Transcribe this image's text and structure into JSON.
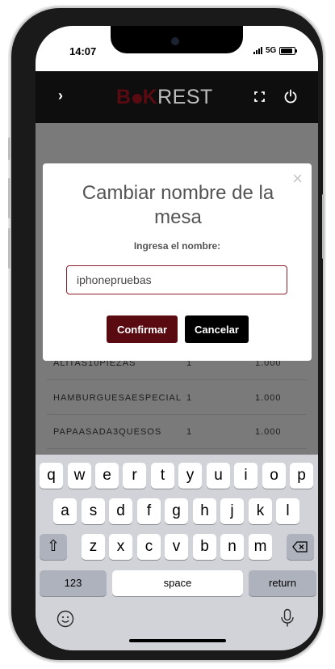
{
  "status": {
    "time": "14:07",
    "network": "5G"
  },
  "app": {
    "logo_b": "B",
    "logo_k": "K",
    "logo_rest": "REST"
  },
  "orders": [
    {
      "name": "ALITAS10PIEZAS",
      "qty": "1",
      "price": "1.000"
    },
    {
      "name": "HAMBURGUESAESPECIAL",
      "qty": "1",
      "price": "1.000"
    },
    {
      "name": "PAPAASADA3QUESOS",
      "qty": "1",
      "price": "1.000"
    }
  ],
  "modal": {
    "title": "Cambiar nombre de la mesa",
    "label": "Ingresa el nombre:",
    "input_value": "iphonepruebas",
    "confirm_label": "Confirmar",
    "cancel_label": "Cancelar",
    "close_glyph": "×"
  },
  "keyboard": {
    "row1": [
      "q",
      "w",
      "e",
      "r",
      "t",
      "y",
      "u",
      "i",
      "o",
      "p"
    ],
    "row2": [
      "a",
      "s",
      "d",
      "f",
      "g",
      "h",
      "j",
      "k",
      "l"
    ],
    "row3": [
      "z",
      "x",
      "c",
      "v",
      "b",
      "n",
      "m"
    ],
    "shift_glyph": "⇧",
    "numbers_label": "123",
    "space_label": "space",
    "return_label": "return"
  },
  "colors": {
    "brand": "#5a0b12",
    "accent_border": "#8a1f2b"
  }
}
